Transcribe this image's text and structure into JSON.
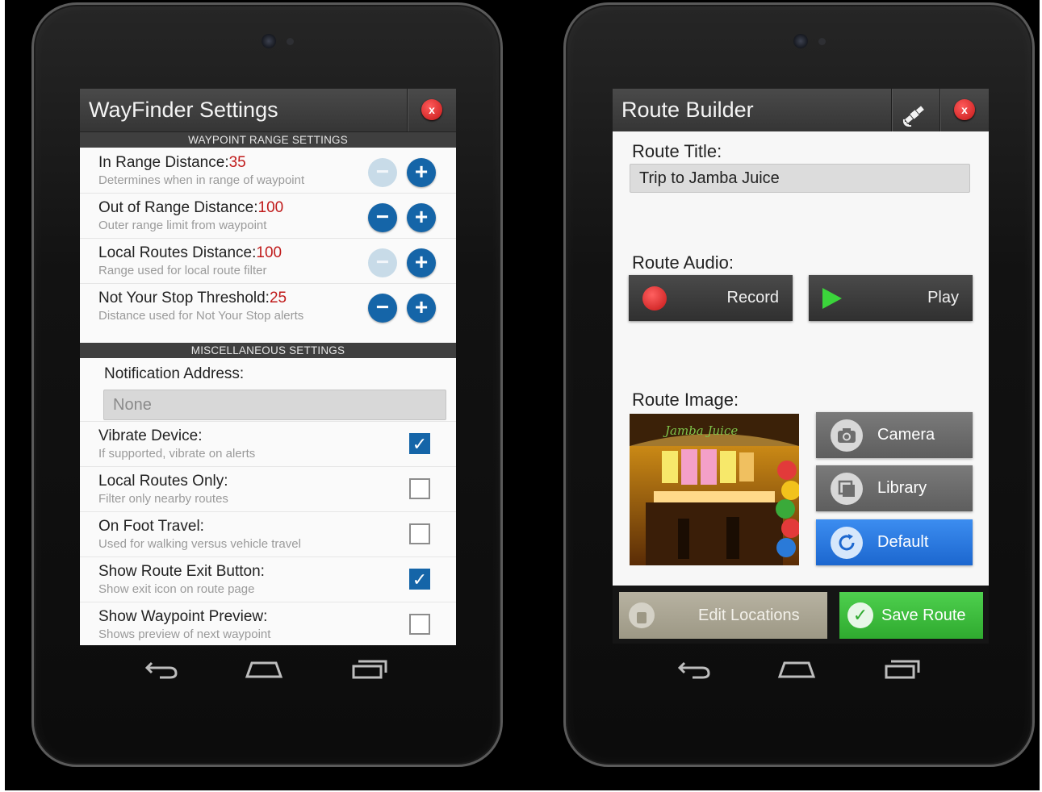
{
  "settings": {
    "title": "WayFinder Settings",
    "close_label": "x",
    "range_header": "WAYPOINT RANGE SETTINGS",
    "range_rows": [
      {
        "label": "In Range Distance:",
        "value": "35",
        "sub": "Determines when in range of waypoint",
        "minus_enabled": false
      },
      {
        "label": "Out of Range Distance:",
        "value": "100",
        "sub": "Outer range limit from waypoint",
        "minus_enabled": true
      },
      {
        "label": "Local Routes Distance:",
        "value": "100",
        "sub": "Range used for local route filter",
        "minus_enabled": false
      },
      {
        "label": "Not Your Stop Threshold:",
        "value": "25",
        "sub": "Distance used for Not Your Stop alerts",
        "minus_enabled": true
      }
    ],
    "misc_header": "MISCELLANEOUS SETTINGS",
    "notification_label": "Notification Address:",
    "notification_placeholder": "None",
    "checks": [
      {
        "label": "Vibrate Device:",
        "sub": "If supported, vibrate on alerts",
        "checked": true
      },
      {
        "label": "Local Routes Only:",
        "sub": "Filter only nearby routes",
        "checked": false
      },
      {
        "label": "On Foot Travel:",
        "sub": "Used for walking versus vehicle travel",
        "checked": false
      },
      {
        "label": "Show Route Exit Button:",
        "sub": "Show exit icon on route page",
        "checked": true
      },
      {
        "label": "Show Waypoint Preview:",
        "sub": "Shows preview of next waypoint",
        "checked": false
      }
    ]
  },
  "builder": {
    "title": "Route Builder",
    "close_label": "x",
    "route_title_label": "Route Title:",
    "route_title_value": "Trip to Jamba Juice",
    "route_audio_label": "Route Audio:",
    "record_label": "Record",
    "play_label": "Play",
    "route_image_label": "Route Image:",
    "image_sign_text": "Jamba Juice",
    "camera_label": "Camera",
    "library_label": "Library",
    "default_label": "Default",
    "edit_locations_label": "Edit Locations",
    "save_route_label": "Save Route"
  },
  "colors": {
    "accent_blue": "#1565a8",
    "value_red": "#c01b1b",
    "save_green": "#3cbf3c",
    "close_red": "#d42020"
  }
}
